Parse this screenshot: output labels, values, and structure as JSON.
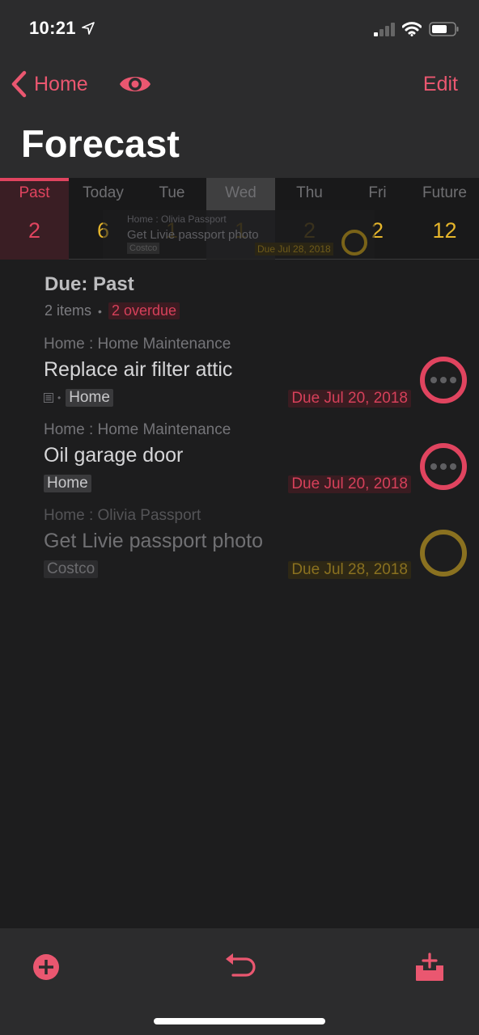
{
  "status_bar": {
    "time": "10:21",
    "location_icon": "location-arrow-icon",
    "signal_icon": "cellular-signal-icon",
    "wifi_icon": "wifi-icon",
    "battery_icon": "battery-icon"
  },
  "nav": {
    "back_label": "Home",
    "back_icon": "chevron-left-icon",
    "view_icon": "eye-icon",
    "edit_label": "Edit",
    "title": "Forecast"
  },
  "forecast": {
    "columns": [
      {
        "label": "Past",
        "count": "2",
        "state": "selected"
      },
      {
        "label": "Today",
        "count": "6",
        "state": "normal"
      },
      {
        "label": "Tue",
        "count": "1",
        "state": "dim"
      },
      {
        "label": "Wed",
        "count": "1",
        "state": "hover"
      },
      {
        "label": "Thu",
        "count": "2",
        "state": "dim"
      },
      {
        "label": "Fri",
        "count": "2",
        "state": "normal"
      },
      {
        "label": "Future",
        "count": "12",
        "state": "normal"
      }
    ]
  },
  "drag_ghost": {
    "crumb": "Home : Olivia Passport",
    "title": "Get Livie passport photo",
    "tag": "Costco",
    "due": "Due Jul 28, 2018"
  },
  "section": {
    "title": "Due: Past",
    "items_count": "2 items",
    "overdue": "2 overdue"
  },
  "tasks": [
    {
      "crumb": "Home : Home Maintenance",
      "title": "Replace air filter attic",
      "has_note": true,
      "tag": "Home",
      "due": "Due Jul 20, 2018",
      "status": "overdue"
    },
    {
      "crumb": "Home : Home Maintenance",
      "title": "Oil garage door",
      "has_note": false,
      "tag": "Home",
      "due": "Due Jul 20, 2018",
      "status": "overdue"
    },
    {
      "crumb": "Home : Olivia Passport",
      "title": "Get Livie passport photo",
      "has_note": false,
      "tag": "Costco",
      "due": "Due Jul 28, 2018",
      "status": "dragging"
    }
  ],
  "toolbar": {
    "add_icon": "plus-circle-icon",
    "undo_icon": "undo-icon",
    "inbox_icon": "inbox-add-icon"
  },
  "colors": {
    "accent": "#ea5770",
    "overdue": "#e0445f",
    "due_soon": "#e5b52b",
    "background": "#1d1d1e",
    "bar": "#2c2c2d"
  }
}
